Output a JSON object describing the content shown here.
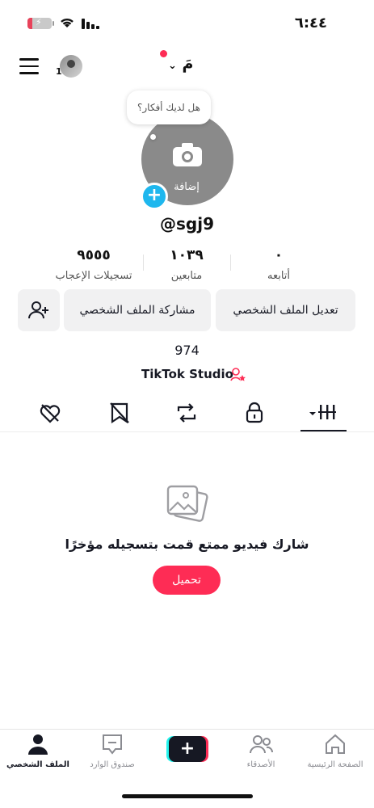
{
  "status_bar": {
    "time": "٦:٤٤"
  },
  "header": {
    "username": "مَ",
    "avatar_badge": "1"
  },
  "profile": {
    "bubble_text": "هل لديك أفكار؟",
    "add_photo_label": "إضافة",
    "handle": "@sgj9",
    "plus": "+"
  },
  "stats": [
    {
      "value": "٠",
      "label": "أتابعه"
    },
    {
      "value": "١٠٣٩",
      "label": "متابعين"
    },
    {
      "value": "٩٥٥٥",
      "label": "تسجيلات الإعجاب"
    }
  ],
  "buttons": {
    "edit_profile": "تعديل الملف الشخصي",
    "share_profile": "مشاركة الملف الشخصي"
  },
  "bio_line": "974",
  "studio_label": "TikTok Studio",
  "empty_state": {
    "message": "شارك فيديو ممتع قمت بتسجيله مؤخرًا",
    "upload_label": "تحميل"
  },
  "bottom_nav": {
    "home": "الصفحة الرئيسية",
    "friends": "الأصدقاء",
    "create": "+",
    "inbox": "صندوق الوارد",
    "profile": "الملف الشخصي"
  },
  "colors": {
    "accent": "#fe2c55",
    "add_badge": "#1eb7ee",
    "text": "#161823"
  },
  "icons": [
    "menu-icon",
    "camera-icon",
    "plus-icon",
    "add-friend-icon",
    "studio-icon",
    "grid-icon",
    "lock-icon",
    "repost-icon",
    "saved-icon",
    "liked-icon",
    "photo-icon",
    "home-icon",
    "friends-icon",
    "create-icon",
    "inbox-icon",
    "profile-icon"
  ]
}
